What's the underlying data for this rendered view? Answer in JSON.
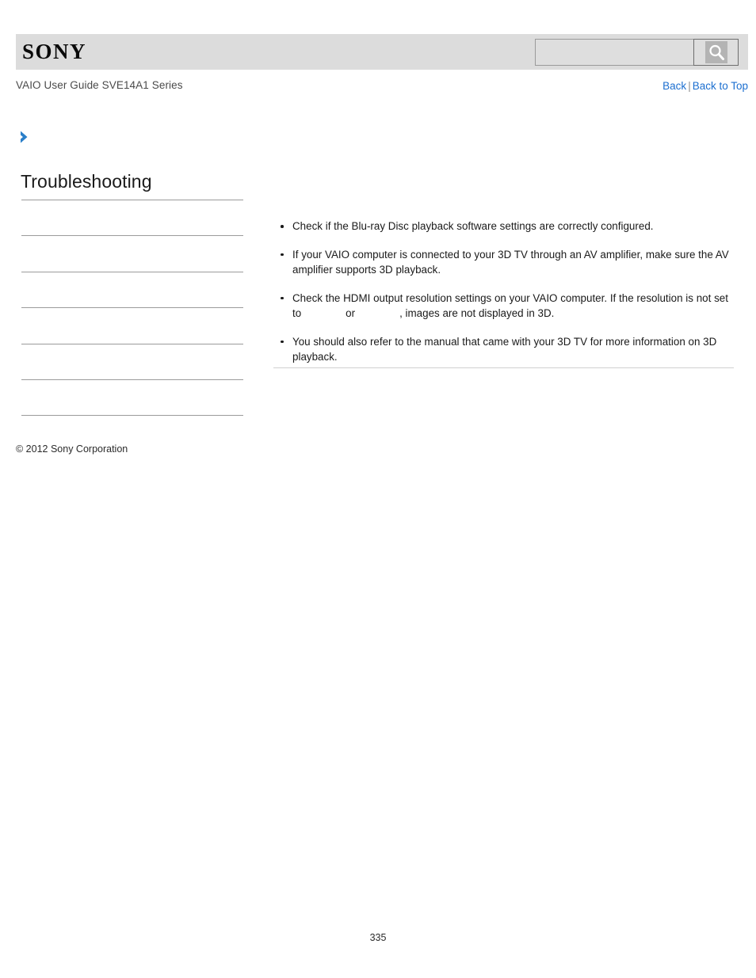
{
  "header": {
    "logo_text": "SONY",
    "search": {
      "value": "",
      "placeholder": "",
      "icon": "search-icon"
    }
  },
  "subheader": {
    "guide_title": "VAIO User Guide SVE14A1 Series",
    "nav": {
      "back_label": "Back",
      "separator": "|",
      "back_to_top_label": "Back to Top"
    }
  },
  "sidebar": {
    "breadcrumb_icon": "chevron-right-icon",
    "title": "Troubleshooting",
    "items": [
      {
        "label": ""
      },
      {
        "label": ""
      },
      {
        "label": ""
      },
      {
        "label": ""
      },
      {
        "label": ""
      },
      {
        "label": ""
      }
    ]
  },
  "main": {
    "bullets": [
      {
        "parts": [
          {
            "type": "text",
            "text": "Check if the Blu-ray Disc playback software settings are correctly configured."
          }
        ]
      },
      {
        "parts": [
          {
            "type": "text",
            "text": "If your VAIO computer is connected to your 3D TV through an AV amplifier, make sure the AV amplifier supports 3D playback."
          }
        ]
      },
      {
        "parts": [
          {
            "type": "text",
            "text": "Check the HDMI output resolution settings on your VAIO computer. If the resolution is not set to "
          },
          {
            "type": "gap",
            "text": "              "
          },
          {
            "type": "text",
            "text": "or "
          },
          {
            "type": "gap",
            "text": "              "
          },
          {
            "type": "text",
            "text": ", images are not displayed in 3D."
          }
        ]
      },
      {
        "parts": [
          {
            "type": "text",
            "text": "You should also refer to the manual that came with your 3D TV for more information on 3D playback."
          }
        ]
      }
    ]
  },
  "footer": {
    "copyright": "© 2012 Sony Corporation",
    "page_number": "335"
  },
  "colors": {
    "header_band": "#dcdcdc",
    "link_blue": "#1c6fd0",
    "arrow_blue": "#2a7fc9",
    "rule_gray": "#9b9b9b",
    "content_rule": "#d0d0d0"
  }
}
